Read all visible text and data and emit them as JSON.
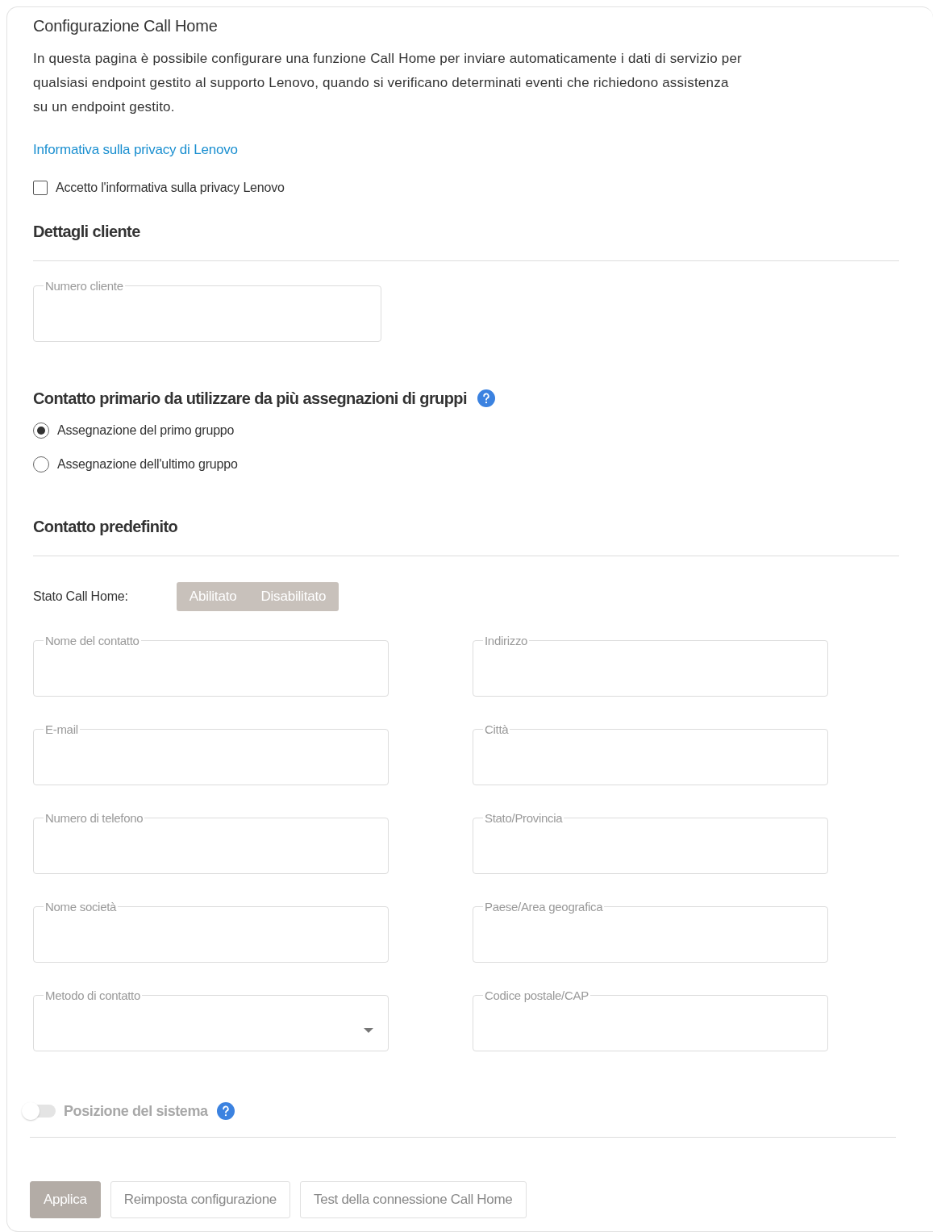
{
  "title": "Configurazione Call Home",
  "description": "In questa pagina è possibile configurare una funzione Call Home per inviare automaticamente i dati di servizio per qualsiasi endpoint gestito al supporto Lenovo, quando si verificano determinati eventi che richiedono assistenza su un endpoint gestito.",
  "privacy_link": "Informativa sulla privacy di Lenovo",
  "privacy_checkbox": {
    "label": "Accetto l'informativa sulla privacy Lenovo",
    "checked": false
  },
  "customer_details": {
    "heading": "Dettagli cliente",
    "fields": [
      {
        "label": "Numero cliente",
        "kind": "text"
      }
    ]
  },
  "primary_contact": {
    "heading": "Contatto primario da utilizzare da più assegnazioni di gruppi",
    "options": [
      {
        "label": "Assegnazione del primo gruppo",
        "selected": true
      },
      {
        "label": "Assegnazione dell'ultimo gruppo",
        "selected": false
      }
    ]
  },
  "default_contact": {
    "heading": "Contatto predefinito",
    "status_label": "Stato Call Home:",
    "status_disabled": true,
    "status_options": [
      {
        "label": "Abilitato",
        "selected": false
      },
      {
        "label": "Disabilitato",
        "selected": false
      }
    ],
    "fields": [
      {
        "label": "Nome del contatto",
        "kind": "text"
      },
      {
        "label": "Indirizzo",
        "kind": "text"
      },
      {
        "label": "E-mail",
        "kind": "text"
      },
      {
        "label": "Città",
        "kind": "text"
      },
      {
        "label": "Numero di telefono",
        "kind": "text"
      },
      {
        "label": "Stato/Provincia",
        "kind": "text"
      },
      {
        "label": "Nome società",
        "kind": "text"
      },
      {
        "label": "Paese/Area geografica",
        "kind": "text"
      },
      {
        "label": "Metodo di contatto",
        "kind": "select"
      },
      {
        "label": "Codice postale/CAP",
        "kind": "text"
      }
    ]
  },
  "system_location": {
    "label": "Posizione del sistema",
    "on": false,
    "disabled": true
  },
  "buttons": [
    {
      "label": "Applica",
      "kind": "primary",
      "disabled": true
    },
    {
      "label": "Reimposta configurazione",
      "kind": "secondary",
      "disabled": false
    },
    {
      "label": "Test della connessione Call Home",
      "kind": "secondary",
      "disabled": false
    }
  ]
}
